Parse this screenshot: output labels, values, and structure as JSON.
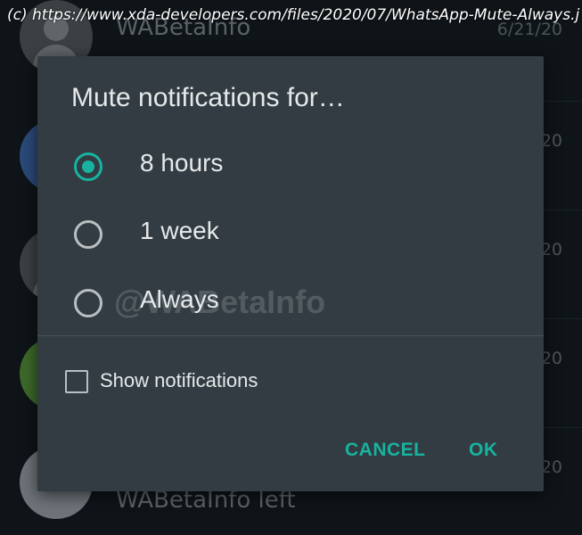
{
  "source_banner": "(c) https://www.xda-developers.com/files/2020/07/WhatsApp-Mute-Always.j",
  "background": {
    "chats": [
      {
        "name": "WABetaInfo",
        "date": "6/21/20"
      },
      {
        "name": "",
        "date": "20"
      },
      {
        "name": "",
        "date": "20"
      },
      {
        "name": "",
        "date": "20"
      },
      {
        "name": "WABetaInfo left",
        "date": "20"
      }
    ]
  },
  "dialog": {
    "title": "Mute notifications for…",
    "options": [
      {
        "label": "8 hours",
        "checked": true
      },
      {
        "label": "1 week",
        "checked": false
      },
      {
        "label": "Always",
        "checked": false
      }
    ],
    "watermark": "@WABetaInfo",
    "show_notifications": {
      "label": "Show notifications",
      "checked": false
    },
    "cancel_label": "CANCEL",
    "ok_label": "OK"
  },
  "colors": {
    "accent": "#18b3a0",
    "dialog_bg": "#323c42",
    "screen_bg": "#0e1418"
  },
  "icons": {
    "radio_selected": "radio-checked-icon",
    "radio_unselected": "radio-unchecked-icon",
    "checkbox": "checkbox-unchecked-icon"
  }
}
